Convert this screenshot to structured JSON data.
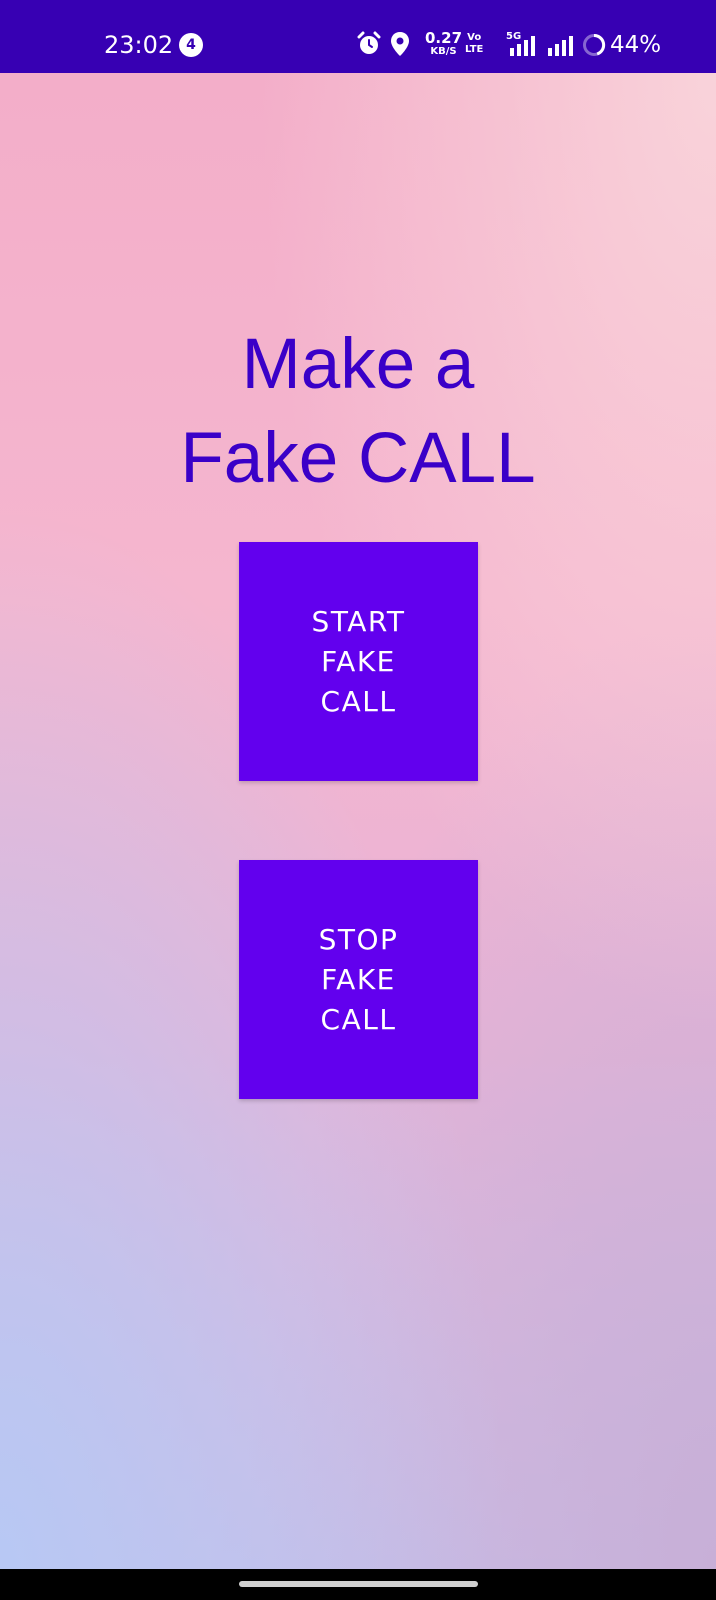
{
  "status_bar": {
    "time": "23:02",
    "notification_count": "4",
    "net_speed_value": "0.27",
    "net_speed_unit": "KB/S",
    "volte_top": "Vo",
    "volte_bottom": "LTE",
    "network_type": "5G",
    "battery_percent": "44%",
    "background_color": "#3700b3"
  },
  "main": {
    "title_line1": "Make a",
    "title_line2": "Fake CALL",
    "start_button_label": "START FAKE CALL",
    "stop_button_label": "STOP FAKE CALL",
    "button_color": "#6200ee",
    "title_color": "#3a00c8"
  },
  "icons": {
    "alarm": "alarm-icon",
    "location": "location-icon",
    "signal": "signal-icon",
    "battery": "battery-ring-icon"
  }
}
